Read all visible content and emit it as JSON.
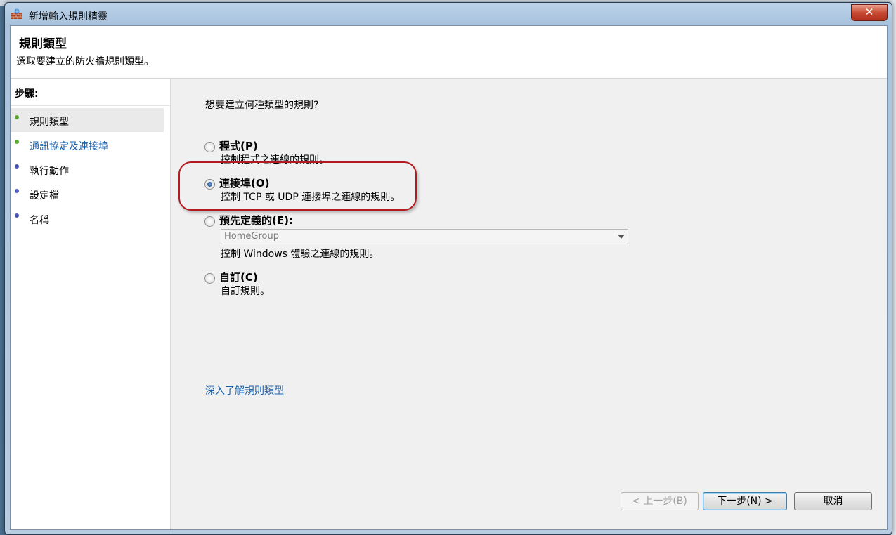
{
  "window": {
    "title": "新增輸入規則精靈",
    "close_label": "✕"
  },
  "header": {
    "title": "規則類型",
    "subtitle": "選取要建立的防火牆規則類型。"
  },
  "sidebar": {
    "steps_label": "步驟:",
    "items": [
      {
        "label": "規則類型",
        "dot_color": "#5aa832"
      },
      {
        "label": "通訊協定及連接埠",
        "dot_color": "#5aa832"
      },
      {
        "label": "執行動作",
        "dot_color": "#4a55b8"
      },
      {
        "label": "設定檔",
        "dot_color": "#4a55b8"
      },
      {
        "label": "名稱",
        "dot_color": "#4a55b8"
      }
    ]
  },
  "main": {
    "question": "想要建立何種類型的規則?",
    "options": [
      {
        "label": "程式(P)",
        "desc": "控制程式之連線的規則。",
        "checked": false
      },
      {
        "label": "連接埠(O)",
        "desc": "控制 TCP 或 UDP 連接埠之連線的規則。",
        "checked": true
      },
      {
        "label": "預先定義的(E):",
        "desc": "控制 Windows 體驗之連線的規則。",
        "checked": false
      },
      {
        "label": "自訂(C)",
        "desc": "自訂規則。",
        "checked": false
      }
    ],
    "predefined_select_value": "HomeGroup",
    "learn_more_link": "深入了解規則類型"
  },
  "footer": {
    "back_label": "< 上一步(B)",
    "next_label": "下一步(N) >",
    "cancel_label": "取消"
  },
  "colors": {
    "accent": "#1a5fa8",
    "highlight_ring": "#b5191e"
  }
}
